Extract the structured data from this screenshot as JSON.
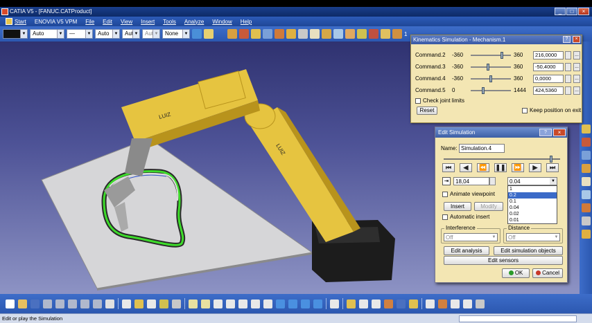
{
  "window": {
    "title": "CATIA V5 - [FANUC.CATProduct]",
    "minimize": "_",
    "maximize": "□",
    "close": "×"
  },
  "menu": {
    "items": [
      "Start",
      "ENOVIA V5 VPM",
      "File",
      "Edit",
      "View",
      "Insert",
      "Tools",
      "Analyze",
      "Window",
      "Help"
    ]
  },
  "toolbar": {
    "color_combo": "",
    "linetype_combo": "Auto",
    "thickness_combo": "Auto",
    "weight_combo": "Aut",
    "weight2_combo": "Aut",
    "layer_combo": "None",
    "filter_label": "1"
  },
  "robot": {
    "brand_upper": "LUIZ",
    "brand_lower": "LUIZ"
  },
  "kinematics": {
    "title": "Kinematics Simulation - Mechanism.1",
    "help": "?",
    "close": "×",
    "commands": [
      {
        "name": "Command.2",
        "min": "-360",
        "max": "360",
        "value": "216,0000",
        "position": 0.8
      },
      {
        "name": "Command.3",
        "min": "-360",
        "max": "360",
        "value": "-50,4000",
        "position": 0.43
      },
      {
        "name": "Command.4",
        "min": "-360",
        "max": "360",
        "value": "0,0000",
        "position": 0.5
      },
      {
        "name": "Command.5",
        "min": "0",
        "max": "1444",
        "value": "424,5360",
        "position": 0.29
      }
    ],
    "check_joint_limits": "Check joint limits",
    "reset": "Reset",
    "keep_position": "Keep position on exit",
    "more_button": "..."
  },
  "edit_simulation": {
    "title": "Edit Simulation",
    "help": "?",
    "close": "×",
    "name_label": "Name:",
    "name_value": "Simulation.4",
    "timeline_position": 0.93,
    "player": {
      "skip_start": "⏮",
      "step_back": "◀",
      "jump_back": "⏪",
      "pause": "❚❚",
      "jump_forward": "⏩",
      "step_forward": "▶",
      "skip_end": "⏭"
    },
    "time_value": "18,04",
    "step_value": "0.04",
    "step_options": [
      "1",
      "0.2",
      "0.1",
      "0.04",
      "0.02",
      "0.01"
    ],
    "step_selected": "0.2",
    "animate_viewpoint": "Animate viewpoint",
    "insert": "Insert",
    "modify": "Modify",
    "automatic_insert": "Automatic insert",
    "interference_label": "Interference",
    "interference_value": "Off",
    "distance_label": "Distance",
    "distance_value": "Off",
    "edit_analysis": "Edit analysis",
    "edit_sim_objects": "Edit simulation objects",
    "edit_sensors": "Edit sensors",
    "ok": "OK",
    "cancel": "Cancel"
  },
  "status": {
    "message": "Edit or play the Simulation"
  },
  "colors": {
    "robot_yellow": "#e6c440",
    "robot_shadow": "#b8931c",
    "robot_base": "#1c1c1c",
    "plate": "#d6d6d8",
    "path_green": "#3ddc2a",
    "panel_bg": "#f3e6b3",
    "ui_blue": "#2c58b0"
  }
}
